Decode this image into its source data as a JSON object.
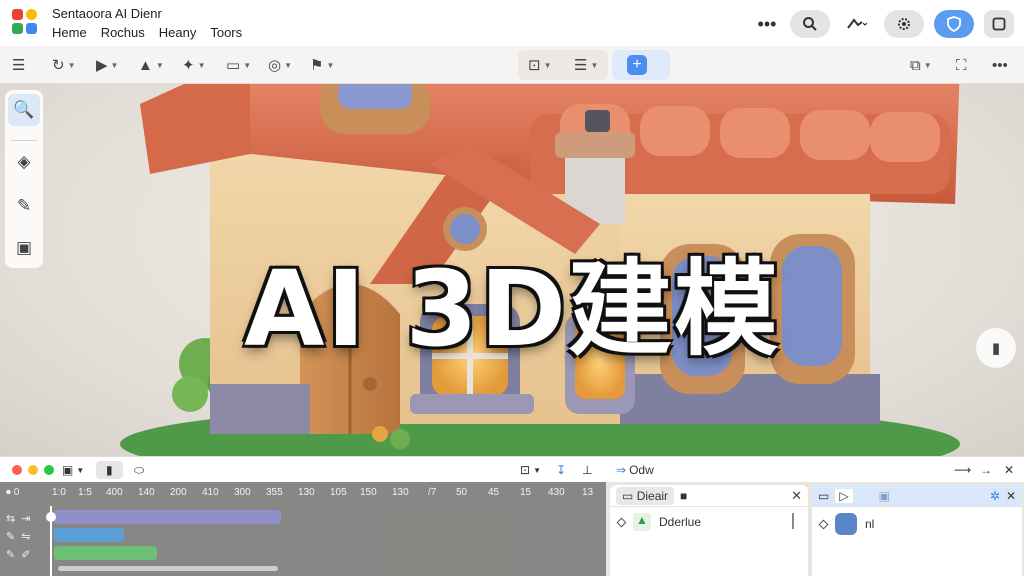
{
  "app": {
    "title": "Sentaoora AI Dienr",
    "menu": [
      "Heme",
      "Rochus",
      "Heany",
      "Toors"
    ],
    "logo_colors": [
      "#ea4335",
      "#fbbc05",
      "#34a853",
      "#4285f4"
    ]
  },
  "titlebar_right": {
    "more_label": "•••",
    "search_icon": "search-icon",
    "brush_icon": "brush-icon",
    "settings_icon": "gear-icon",
    "shield_icon": "shield-icon",
    "window_icon": "window-icon"
  },
  "toolbar": {
    "menu_glyph": "☰",
    "tools": [
      "↻",
      "▶",
      "▲",
      "✦",
      "▭",
      "◎",
      "⚑"
    ],
    "center_tools": [
      "⊡",
      "☰"
    ],
    "add_label": "+",
    "right_tools": [
      "⧉",
      "⛶",
      "•••"
    ]
  },
  "left_tools": {
    "items": [
      {
        "name": "search-tool",
        "glyph": "🔍"
      },
      {
        "name": "move-tool",
        "glyph": "◈"
      },
      {
        "name": "paint-tool",
        "glyph": "✎"
      },
      {
        "name": "object-tool",
        "glyph": "▣"
      }
    ]
  },
  "overlay": {
    "title": "AI 3D建模"
  },
  "side_float": {
    "glyph": "▮"
  },
  "bottombar": {
    "traffic_lights": [
      "#ff5f57",
      "#febc2e",
      "#28c840"
    ],
    "items": [
      "▣",
      "▮",
      "⬭"
    ],
    "right_label": "Odw",
    "right_tools": [
      "⊡",
      "↧",
      "⊥",
      "⟶",
      "→",
      "✕"
    ]
  },
  "timeline": {
    "ticks": [
      "1:0",
      "1:5",
      "400",
      "140",
      "200",
      "410",
      "300",
      "355",
      "130",
      "105",
      "150",
      "130",
      "/7",
      "50",
      "45",
      "15",
      "430",
      "13"
    ],
    "rows": [
      {
        "left": "⇆",
        "right": "⇥"
      },
      {
        "left": "✎",
        "right": "⇋"
      },
      {
        "left": "✎",
        "right": "✐"
      }
    ],
    "clips": [
      {
        "color": "#8f8fc9",
        "start": 0.0,
        "end": 0.42,
        "row": 0
      },
      {
        "color": "#5b9fd6",
        "start": 0.0,
        "end": 0.13,
        "row": 1
      },
      {
        "color": "#6cbf73",
        "start": 0.0,
        "end": 0.19,
        "row": 2
      }
    ]
  },
  "panel_objects": {
    "tab_label": "Dieair",
    "row_label": "Dderlue",
    "close": "✕"
  },
  "panel_render": {
    "tabs": [
      "▭",
      "▷",
      "▣",
      "✲"
    ],
    "row_label": "nl",
    "close": "✕"
  }
}
